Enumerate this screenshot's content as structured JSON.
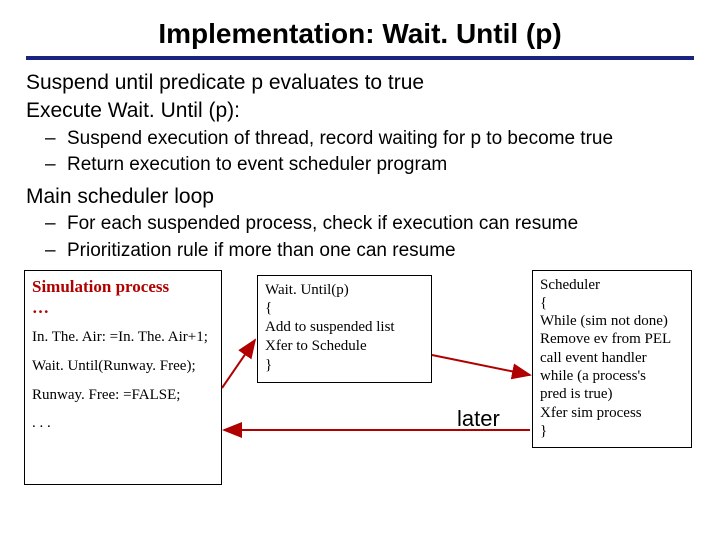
{
  "title": "Implementation: Wait. Until (p)",
  "body": {
    "line1": "Suspend until predicate p evaluates to true",
    "line2": "Execute Wait. Until (p):"
  },
  "bullets1": {
    "b1": "Suspend execution of thread, record waiting for p to become true",
    "b2": "Return execution to event scheduler program"
  },
  "body2": "Main scheduler loop",
  "bullets2": {
    "b1": "For each suspended process, check if execution can resume",
    "b2": "Prioritization rule if more than one can resume"
  },
  "sim_box": {
    "t1": "Simulation process",
    "t2": "…",
    "t3": "In. The. Air: =In. The. Air+1;",
    "t4": "Wait. Until(Runway. Free);",
    "t5": "Runway. Free: =FALSE;",
    "t6": ". . ."
  },
  "wait_box": {
    "l1": "Wait. Until(p)",
    "l2": "{",
    "l3": "Add to suspended list",
    "l4": "Xfer to Schedule",
    "l5": "}"
  },
  "sched_box": {
    "l1": "Scheduler",
    "l2": "{",
    "l3": "While (sim not done)",
    "l4": " Remove ev from PEL",
    "l5": " call event handler",
    "l6": " while (a process's",
    "l7": "       pred is true)",
    "l8": "  Xfer sim process",
    "l9": "}"
  },
  "later": "later"
}
